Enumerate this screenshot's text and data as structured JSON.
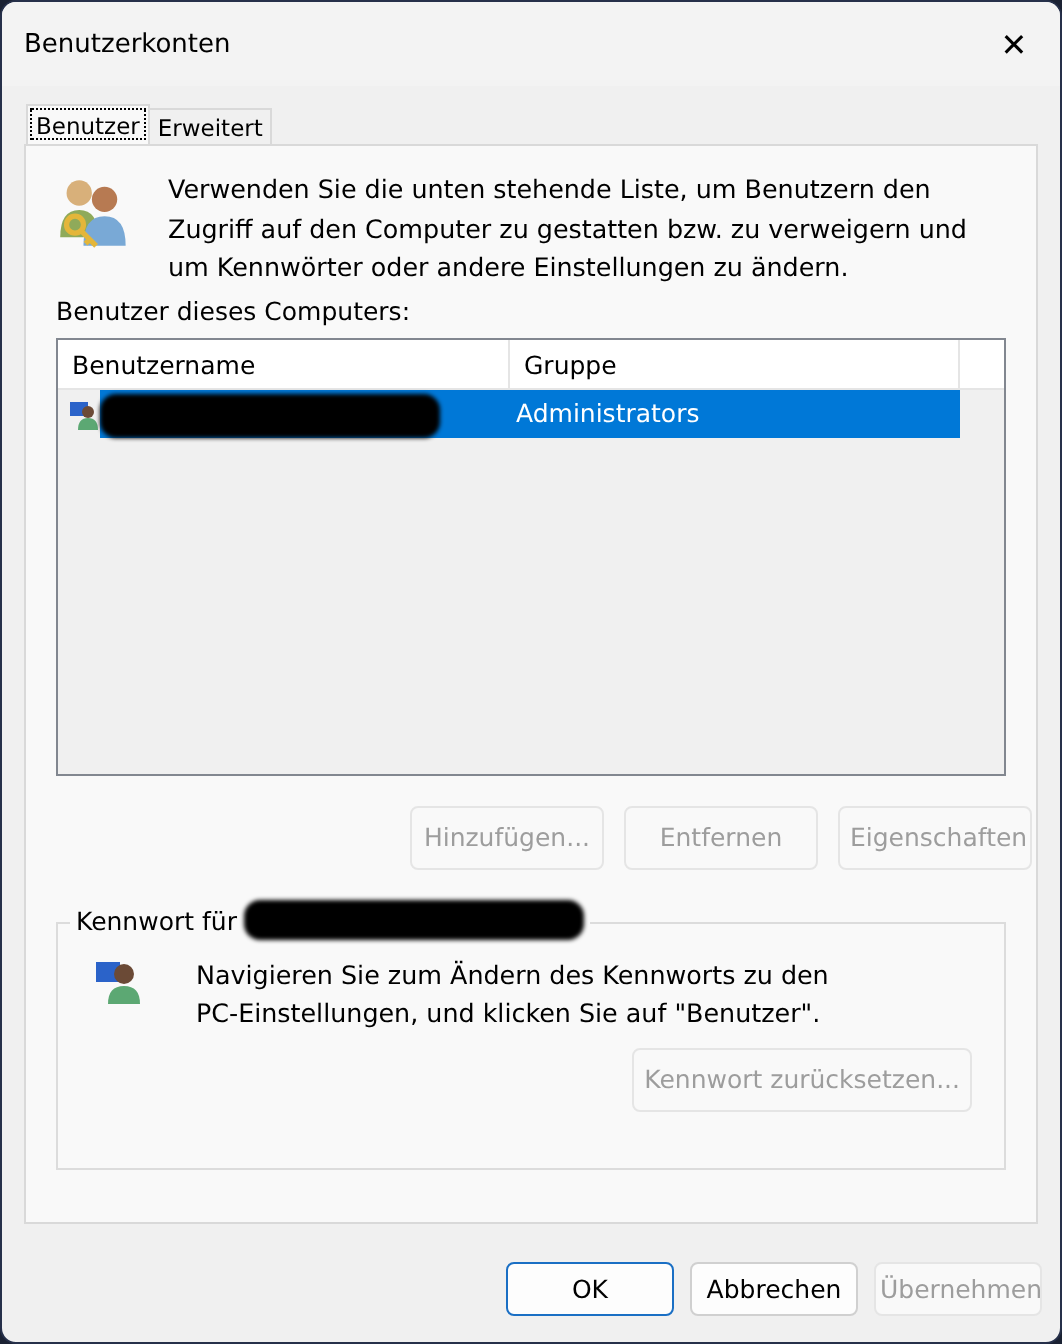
{
  "window": {
    "title": "Benutzerkonten",
    "close": "✕"
  },
  "tabs": [
    {
      "label": "Benutzer",
      "selected": true
    },
    {
      "label": "Erweitert",
      "selected": false
    }
  ],
  "intro": "Verwenden Sie die unten stehende Liste, um Benutzern den Zugriff auf den Computer zu gestatten bzw. zu verweigern und um Kennwörter oder andere Einstellungen zu ändern.",
  "users_label": "Benutzer dieses Computers:",
  "table": {
    "columns": [
      "Benutzername",
      "Gruppe"
    ],
    "rows": [
      {
        "user_redacted": true,
        "group": "Administrators",
        "selected": true
      }
    ]
  },
  "list_buttons": [
    {
      "label": "Hinzufügen...",
      "disabled": true
    },
    {
      "label": "Entfernen",
      "disabled": true
    },
    {
      "label": "Eigenschaften",
      "disabled": true
    }
  ],
  "password_group": {
    "label": "Kennwort für",
    "name_redacted": true,
    "text": "Navigieren Sie zum Ändern des Kennworts zu den PC-Einstellungen, und klicken Sie auf \"Benutzer\".",
    "button": {
      "label": "Kennwort zurücksetzen...",
      "disabled": true
    }
  },
  "dialog_buttons": [
    {
      "label": "OK",
      "disabled": false,
      "default": true
    },
    {
      "label": "Abbrechen",
      "disabled": false,
      "default": false
    },
    {
      "label": "Übernehmen",
      "disabled": true,
      "default": false
    }
  ]
}
